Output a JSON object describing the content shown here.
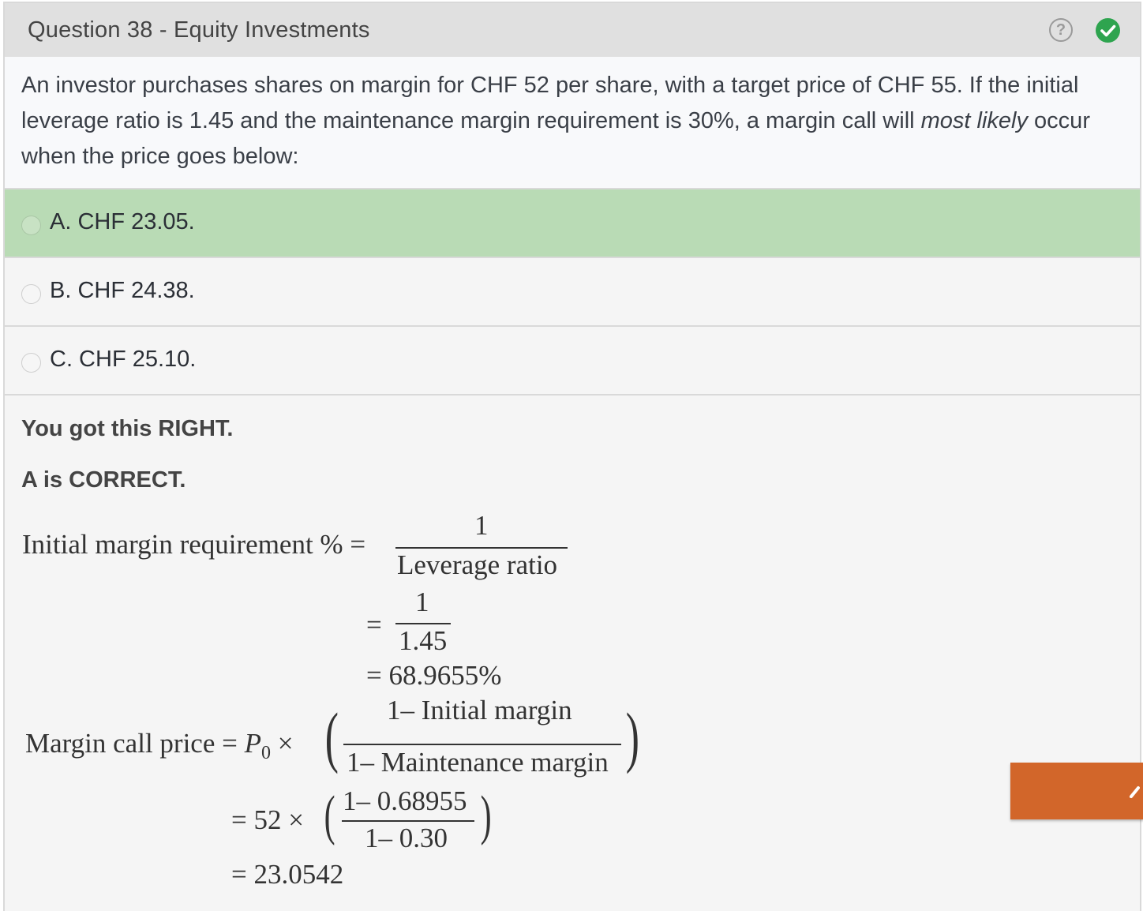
{
  "header": {
    "title": "Question 38 - Equity Investments",
    "help_icon": "question-circle-icon",
    "status_icon": "check-circle-icon",
    "status_color": "#2ea44f"
  },
  "question": {
    "text_part1": "An investor purchases shares on margin for CHF 52 per share, with a target price of CHF 55.  If the initial leverage ratio is 1.45 and the maintenance margin requirement is 30%, a margin call will ",
    "emph1": "most likely",
    "text_part2": " occur when the price goes below:"
  },
  "options": [
    {
      "label": "A. CHF 23.05.",
      "selected": true,
      "correct": true
    },
    {
      "label": "B. CHF 24.38.",
      "selected": false,
      "correct": false
    },
    {
      "label": "C. CHF 25.10.",
      "selected": false,
      "correct": false
    }
  ],
  "explanation": {
    "result": "You got this RIGHT.",
    "correct_answer": "A is CORRECT.",
    "eq1_lhs": "Initial margin requirement % =",
    "eq1_num": "1",
    "eq1_den": "Leverage ratio",
    "eq1_eq2": "=",
    "eq1_num2": "1",
    "eq1_den2": "1.45",
    "eq1_result": "= 68.9655%",
    "eq2_lhs": "Margin call price = ",
    "eq2_p": "P",
    "eq2_sub": "0",
    "eq2_times": " ×",
    "eq2_num": "1– Initial margin",
    "eq2_den": "1– Maintenance margin",
    "eq2_step": "= 52 ×",
    "eq2_num2": "1– 0.68955",
    "eq2_den2": "1– 0.30",
    "eq2_result": "= 23.0542"
  },
  "side_tab": {
    "icon": "pencil-icon",
    "color": "#d2662a"
  },
  "colors": {
    "correct_bg": "#b9dbb5",
    "header_bg": "#e0e0e0"
  }
}
